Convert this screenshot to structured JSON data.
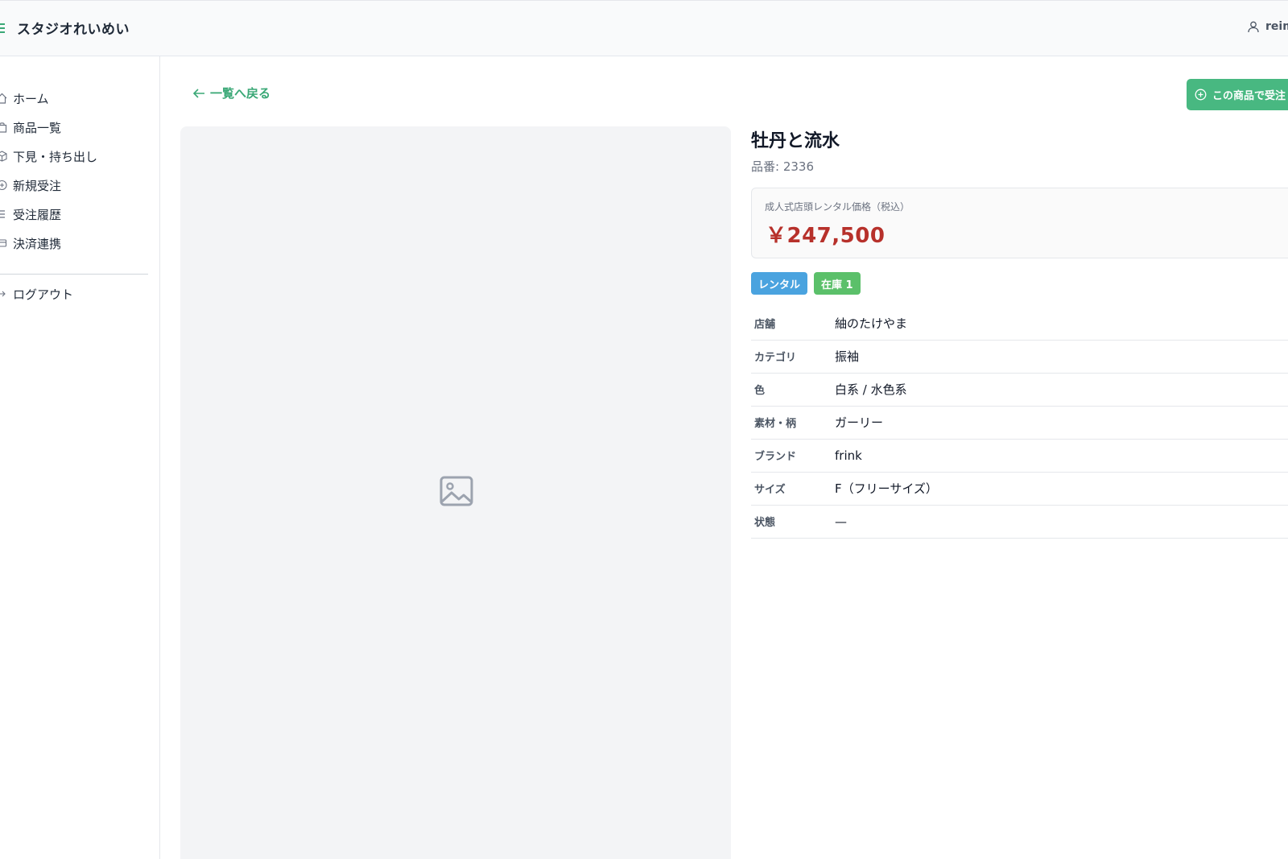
{
  "app": {
    "title": "スタジオれいめい"
  },
  "user": {
    "name": "reim",
    "icon": "user-icon"
  },
  "sidebar": {
    "items": [
      {
        "label": "ホーム",
        "icon": "home-icon"
      },
      {
        "label": "商品一覧",
        "icon": "shopping-bag-icon"
      },
      {
        "label": "下見・持ち出し",
        "icon": "box-icon"
      },
      {
        "label": "新規受注",
        "icon": "plus-circle-icon"
      },
      {
        "label": "受注履歴",
        "icon": "list-icon"
      },
      {
        "label": "決済連携",
        "icon": "credit-card-icon"
      },
      {
        "label": "ログアウト",
        "icon": "arrow-right-icon"
      }
    ]
  },
  "main": {
    "back_label": "一覧へ戻る",
    "order_button_label": "この商品で受注",
    "product": {
      "name": "牡丹と流水",
      "code_label": "品番: 2336",
      "price_label": "成人式店頭レンタル価格（税込）",
      "price": "￥247,500",
      "badges": {
        "rental": "レンタル",
        "stock": "在庫 1"
      },
      "specs": [
        {
          "key": "店舗",
          "value": "紬のたけやま"
        },
        {
          "key": "カテゴリ",
          "value": "振袖"
        },
        {
          "key": "色",
          "value": "白系 / 水色系"
        },
        {
          "key": "素材・柄",
          "value": "ガーリー"
        },
        {
          "key": "ブランド",
          "value": "frink"
        },
        {
          "key": "サイズ",
          "value": "F（フリーサイズ）"
        },
        {
          "key": "状態",
          "value": "—"
        }
      ]
    },
    "image_placeholder_icon": "image-icon"
  },
  "colors": {
    "accent": "#3aa876",
    "button": "#48b881",
    "price": "#b7312b",
    "badge_rental": "#4aa3df",
    "badge_stock": "#5bc06a"
  }
}
